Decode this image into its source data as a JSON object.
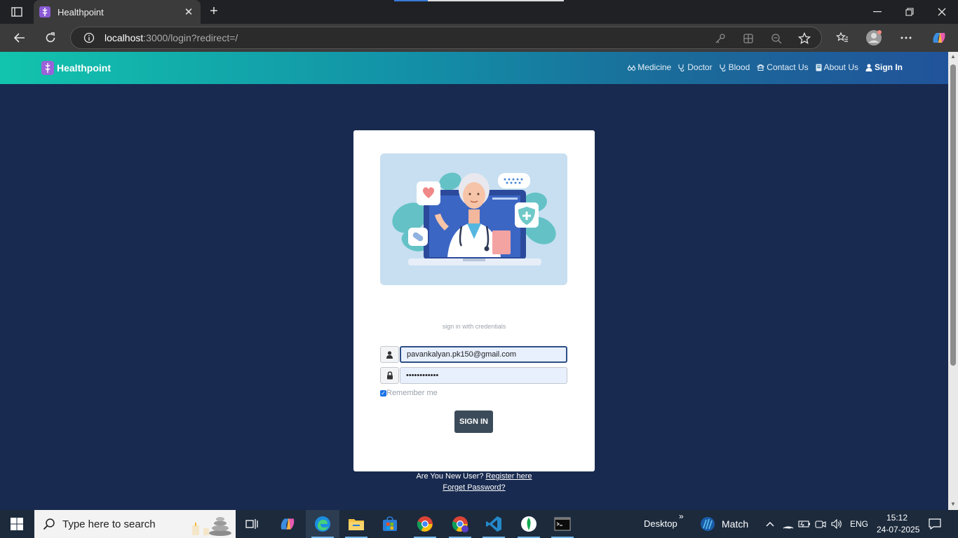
{
  "browser": {
    "tab_title": "Healthpoint",
    "url_host": "localhost",
    "url_rest": ":3000/login?redirect=/"
  },
  "site": {
    "brand": "Healthpoint",
    "menu": [
      {
        "label": "Medicine",
        "icon": "binoculars-icon"
      },
      {
        "label": "Doctor",
        "icon": "stethoscope-icon"
      },
      {
        "label": "Blood",
        "icon": "stethoscope-icon"
      },
      {
        "label": "Contact Us",
        "icon": "contact-icon"
      },
      {
        "label": "About Us",
        "icon": "book-icon"
      },
      {
        "label": "Sign In",
        "icon": "user-icon"
      }
    ]
  },
  "login": {
    "subtitle": "sign in with credentials",
    "email_value": "pavankalyan.pk150@gmail.com",
    "password_value": "••••••••••••",
    "remember_label": "Remember me",
    "remember_checked": true,
    "submit_label": "SIGN IN",
    "new_user_text": "Are You New User?",
    "register_link": "Register here",
    "forgot_link": "Forget Password?"
  },
  "taskbar": {
    "search_placeholder": "Type here to search",
    "desktop_label": "Desktop",
    "weather_label": "Match",
    "language": "ENG",
    "time": "15:12",
    "date": "24-07-2025"
  },
  "colors": {
    "page_bg": "#182a4f",
    "header_gradient_start": "#12c4ad",
    "header_gradient_end": "#21539a",
    "button_bg": "#3c4b5a"
  }
}
